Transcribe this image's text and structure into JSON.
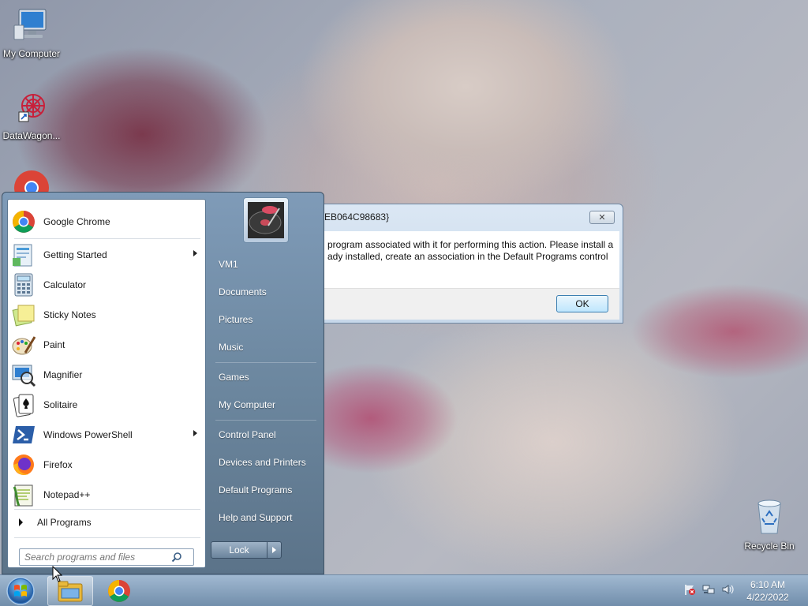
{
  "desktop": {
    "icons": [
      {
        "label": "My Computer",
        "icon": "computer-icon"
      },
      {
        "label": "DataWagon...",
        "icon": "datawagon-shortcut-icon"
      },
      {
        "label": "",
        "icon": "chrome-icon"
      },
      {
        "label": "Recycle Bin",
        "icon": "recycle-bin-icon"
      }
    ]
  },
  "start_menu": {
    "programs": [
      {
        "label": "Google Chrome",
        "icon": "chrome-icon",
        "submenu": false
      },
      {
        "label": "Getting Started",
        "icon": "getting-started-icon",
        "submenu": true
      },
      {
        "label": "Calculator",
        "icon": "calculator-icon",
        "submenu": false
      },
      {
        "label": "Sticky Notes",
        "icon": "sticky-notes-icon",
        "submenu": false
      },
      {
        "label": "Paint",
        "icon": "paint-icon",
        "submenu": false
      },
      {
        "label": "Magnifier",
        "icon": "magnifier-icon",
        "submenu": false
      },
      {
        "label": "Solitaire",
        "icon": "solitaire-icon",
        "submenu": false
      },
      {
        "label": "Windows PowerShell",
        "icon": "powershell-icon",
        "submenu": true
      },
      {
        "label": "Firefox",
        "icon": "firefox-icon",
        "submenu": false
      },
      {
        "label": "Notepad++",
        "icon": "notepadpp-icon",
        "submenu": false
      }
    ],
    "all_programs": "All Programs",
    "search_placeholder": "Search programs and files",
    "right_items": [
      "VM1",
      "Documents",
      "Pictures",
      "Music",
      "Games",
      "My Computer",
      "Control Panel",
      "Devices and Printers",
      "Default Programs",
      "Help and Support"
    ],
    "lock_label": "Lock"
  },
  "dialog": {
    "title": "EB064C98683}",
    "message_line1": "program associated with it for performing this action. Please install a",
    "message_line2": "ady installed, create an association in the Default Programs control",
    "close_glyph": "✕",
    "ok_label": "OK"
  },
  "taskbar": {
    "time": "6:10 AM",
    "date": "4/22/2022",
    "pinned": [
      "file-explorer-icon",
      "chrome-icon"
    ],
    "tray": [
      "action-center-flag-icon",
      "network-icon",
      "volume-icon"
    ]
  }
}
